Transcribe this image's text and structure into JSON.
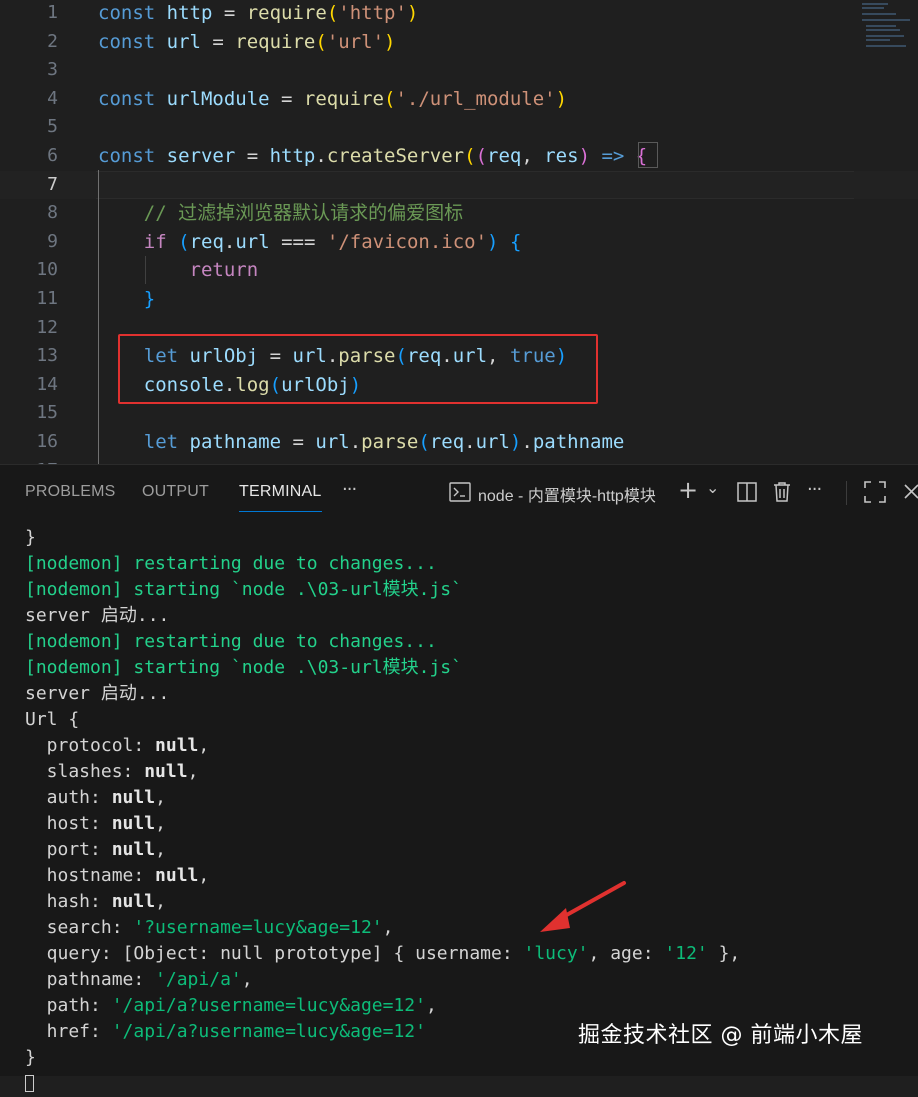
{
  "editor": {
    "lines": [
      {
        "n": "1",
        "segments": [
          {
            "t": "const ",
            "c": "kw"
          },
          {
            "t": "http",
            "c": "var"
          },
          {
            "t": " = ",
            "c": "pl"
          },
          {
            "t": "require",
            "c": "fn"
          },
          {
            "t": "(",
            "c": "br1"
          },
          {
            "t": "'http'",
            "c": "str"
          },
          {
            "t": ")",
            "c": "br1"
          }
        ]
      },
      {
        "n": "2",
        "segments": [
          {
            "t": "const ",
            "c": "kw"
          },
          {
            "t": "url",
            "c": "var"
          },
          {
            "t": " = ",
            "c": "pl"
          },
          {
            "t": "require",
            "c": "fn"
          },
          {
            "t": "(",
            "c": "br1"
          },
          {
            "t": "'url'",
            "c": "str"
          },
          {
            "t": ")",
            "c": "br1"
          }
        ]
      },
      {
        "n": "3",
        "segments": []
      },
      {
        "n": "4",
        "segments": [
          {
            "t": "const ",
            "c": "kw"
          },
          {
            "t": "urlModule",
            "c": "var"
          },
          {
            "t": " = ",
            "c": "pl"
          },
          {
            "t": "require",
            "c": "fn"
          },
          {
            "t": "(",
            "c": "br1"
          },
          {
            "t": "'./url_module'",
            "c": "str"
          },
          {
            "t": ")",
            "c": "br1"
          }
        ]
      },
      {
        "n": "5",
        "segments": []
      },
      {
        "n": "6",
        "segments": [
          {
            "t": "const ",
            "c": "kw"
          },
          {
            "t": "server",
            "c": "var"
          },
          {
            "t": " = ",
            "c": "pl"
          },
          {
            "t": "http",
            "c": "var"
          },
          {
            "t": ".",
            "c": "pl"
          },
          {
            "t": "createServer",
            "c": "fn"
          },
          {
            "t": "(",
            "c": "br1"
          },
          {
            "t": "(",
            "c": "br2"
          },
          {
            "t": "req",
            "c": "var"
          },
          {
            "t": ", ",
            "c": "pl"
          },
          {
            "t": "res",
            "c": "var"
          },
          {
            "t": ")",
            "c": "br2"
          },
          {
            "t": " => ",
            "c": "kw"
          },
          {
            "t": "{",
            "c": "br2"
          }
        ]
      },
      {
        "n": "7",
        "segments": [],
        "active": true
      },
      {
        "n": "8",
        "segments": [
          {
            "t": "    // 过滤掉浏览器默认请求的偏爱图标",
            "c": "cmt"
          }
        ]
      },
      {
        "n": "9",
        "segments": [
          {
            "t": "    ",
            "c": "pl"
          },
          {
            "t": "if",
            "c": "ctl"
          },
          {
            "t": " ",
            "c": "pl"
          },
          {
            "t": "(",
            "c": "br3"
          },
          {
            "t": "req",
            "c": "var"
          },
          {
            "t": ".",
            "c": "pl"
          },
          {
            "t": "url",
            "c": "var"
          },
          {
            "t": " === ",
            "c": "pl"
          },
          {
            "t": "'/favicon.ico'",
            "c": "str"
          },
          {
            "t": ")",
            "c": "br3"
          },
          {
            "t": " ",
            "c": "pl"
          },
          {
            "t": "{",
            "c": "br3"
          }
        ]
      },
      {
        "n": "10",
        "segments": [
          {
            "t": "        ",
            "c": "pl"
          },
          {
            "t": "return",
            "c": "ctl"
          }
        ]
      },
      {
        "n": "11",
        "segments": [
          {
            "t": "    ",
            "c": "pl"
          },
          {
            "t": "}",
            "c": "br3"
          }
        ]
      },
      {
        "n": "12",
        "segments": []
      },
      {
        "n": "13",
        "segments": [
          {
            "t": "    ",
            "c": "pl"
          },
          {
            "t": "let ",
            "c": "kw"
          },
          {
            "t": "urlObj",
            "c": "var"
          },
          {
            "t": " = ",
            "c": "pl"
          },
          {
            "t": "url",
            "c": "var"
          },
          {
            "t": ".",
            "c": "pl"
          },
          {
            "t": "parse",
            "c": "fn"
          },
          {
            "t": "(",
            "c": "br3"
          },
          {
            "t": "req",
            "c": "var"
          },
          {
            "t": ".",
            "c": "pl"
          },
          {
            "t": "url",
            "c": "var"
          },
          {
            "t": ", ",
            "c": "pl"
          },
          {
            "t": "true",
            "c": "kw"
          },
          {
            "t": ")",
            "c": "br3"
          }
        ]
      },
      {
        "n": "14",
        "segments": [
          {
            "t": "    ",
            "c": "pl"
          },
          {
            "t": "console",
            "c": "var"
          },
          {
            "t": ".",
            "c": "pl"
          },
          {
            "t": "log",
            "c": "fn"
          },
          {
            "t": "(",
            "c": "br3"
          },
          {
            "t": "urlObj",
            "c": "var"
          },
          {
            "t": ")",
            "c": "br3"
          }
        ]
      },
      {
        "n": "15",
        "segments": []
      },
      {
        "n": "16",
        "segments": [
          {
            "t": "    ",
            "c": "pl"
          },
          {
            "t": "let ",
            "c": "kw"
          },
          {
            "t": "pathname",
            "c": "var"
          },
          {
            "t": " = ",
            "c": "pl"
          },
          {
            "t": "url",
            "c": "var"
          },
          {
            "t": ".",
            "c": "pl"
          },
          {
            "t": "parse",
            "c": "fn"
          },
          {
            "t": "(",
            "c": "br3"
          },
          {
            "t": "req",
            "c": "var"
          },
          {
            "t": ".",
            "c": "pl"
          },
          {
            "t": "url",
            "c": "var"
          },
          {
            "t": ")",
            "c": "br3"
          },
          {
            "t": ".",
            "c": "pl"
          },
          {
            "t": "pathname",
            "c": "var"
          }
        ]
      },
      {
        "n": "17",
        "segments": []
      }
    ]
  },
  "panel": {
    "tabs": [
      {
        "label": "PROBLEMS"
      },
      {
        "label": "OUTPUT"
      },
      {
        "label": "TERMINAL",
        "active": true
      }
    ],
    "more_label": "···",
    "terminal_title": "node - 内置模块-http模块",
    "actions": {
      "add": "+",
      "chevron": "⌄",
      "more": "···"
    }
  },
  "terminal": {
    "lines": [
      {
        "segments": [
          {
            "t": "}",
            "c": "pl"
          }
        ]
      },
      {
        "segments": [
          {
            "t": "[nodemon] restarting due to changes...",
            "c": "ng"
          }
        ]
      },
      {
        "segments": [
          {
            "t": "[nodemon] starting `node .\\03-url模块.js`",
            "c": "ng"
          }
        ]
      },
      {
        "segments": [
          {
            "t": "server 启动...",
            "c": "pl"
          }
        ]
      },
      {
        "segments": [
          {
            "t": "[nodemon] restarting due to changes...",
            "c": "ng"
          }
        ]
      },
      {
        "segments": [
          {
            "t": "[nodemon] starting `node .\\03-url模块.js`",
            "c": "ng"
          }
        ]
      },
      {
        "segments": [
          {
            "t": "server 启动...",
            "c": "pl"
          }
        ]
      },
      {
        "segments": [
          {
            "t": "Url {",
            "c": "pl"
          }
        ]
      },
      {
        "segments": [
          {
            "t": "  protocol: ",
            "c": "pl"
          },
          {
            "t": "null",
            "c": "tw"
          },
          {
            "t": ",",
            "c": "pl"
          }
        ]
      },
      {
        "segments": [
          {
            "t": "  slashes: ",
            "c": "pl"
          },
          {
            "t": "null",
            "c": "tw"
          },
          {
            "t": ",",
            "c": "pl"
          }
        ]
      },
      {
        "segments": [
          {
            "t": "  auth: ",
            "c": "pl"
          },
          {
            "t": "null",
            "c": "tw"
          },
          {
            "t": ",",
            "c": "pl"
          }
        ]
      },
      {
        "segments": [
          {
            "t": "  host: ",
            "c": "pl"
          },
          {
            "t": "null",
            "c": "tw"
          },
          {
            "t": ",",
            "c": "pl"
          }
        ]
      },
      {
        "segments": [
          {
            "t": "  port: ",
            "c": "pl"
          },
          {
            "t": "null",
            "c": "tw"
          },
          {
            "t": ",",
            "c": "pl"
          }
        ]
      },
      {
        "segments": [
          {
            "t": "  hostname: ",
            "c": "pl"
          },
          {
            "t": "null",
            "c": "tw"
          },
          {
            "t": ",",
            "c": "pl"
          }
        ]
      },
      {
        "segments": [
          {
            "t": "  hash: ",
            "c": "pl"
          },
          {
            "t": "null",
            "c": "tw"
          },
          {
            "t": ",",
            "c": "pl"
          }
        ]
      },
      {
        "segments": [
          {
            "t": "  search: ",
            "c": "pl"
          },
          {
            "t": "'?username=lucy&age=12'",
            "c": "tg"
          },
          {
            "t": ",",
            "c": "pl"
          }
        ]
      },
      {
        "segments": [
          {
            "t": "  query: [Object: null prototype] { username: ",
            "c": "pl"
          },
          {
            "t": "'lucy'",
            "c": "tg"
          },
          {
            "t": ", age: ",
            "c": "pl"
          },
          {
            "t": "'12'",
            "c": "tg"
          },
          {
            "t": " },",
            "c": "pl"
          }
        ]
      },
      {
        "segments": [
          {
            "t": "  pathname: ",
            "c": "pl"
          },
          {
            "t": "'/api/a'",
            "c": "tg"
          },
          {
            "t": ",",
            "c": "pl"
          }
        ]
      },
      {
        "segments": [
          {
            "t": "  path: ",
            "c": "pl"
          },
          {
            "t": "'/api/a?username=lucy&age=12'",
            "c": "tg"
          },
          {
            "t": ",",
            "c": "pl"
          }
        ]
      },
      {
        "segments": [
          {
            "t": "  href: ",
            "c": "pl"
          },
          {
            "t": "'/api/a?username=lucy&age=12'",
            "c": "tg"
          }
        ]
      },
      {
        "segments": [
          {
            "t": "}",
            "c": "pl"
          }
        ]
      }
    ]
  },
  "watermark": "掘金技术社区 @ 前端小木屋",
  "colors": {
    "highlight_box": "#e0312f",
    "arrow": "#e0312f",
    "terminal_green": "#23d18b",
    "accent": "#0078d4"
  }
}
